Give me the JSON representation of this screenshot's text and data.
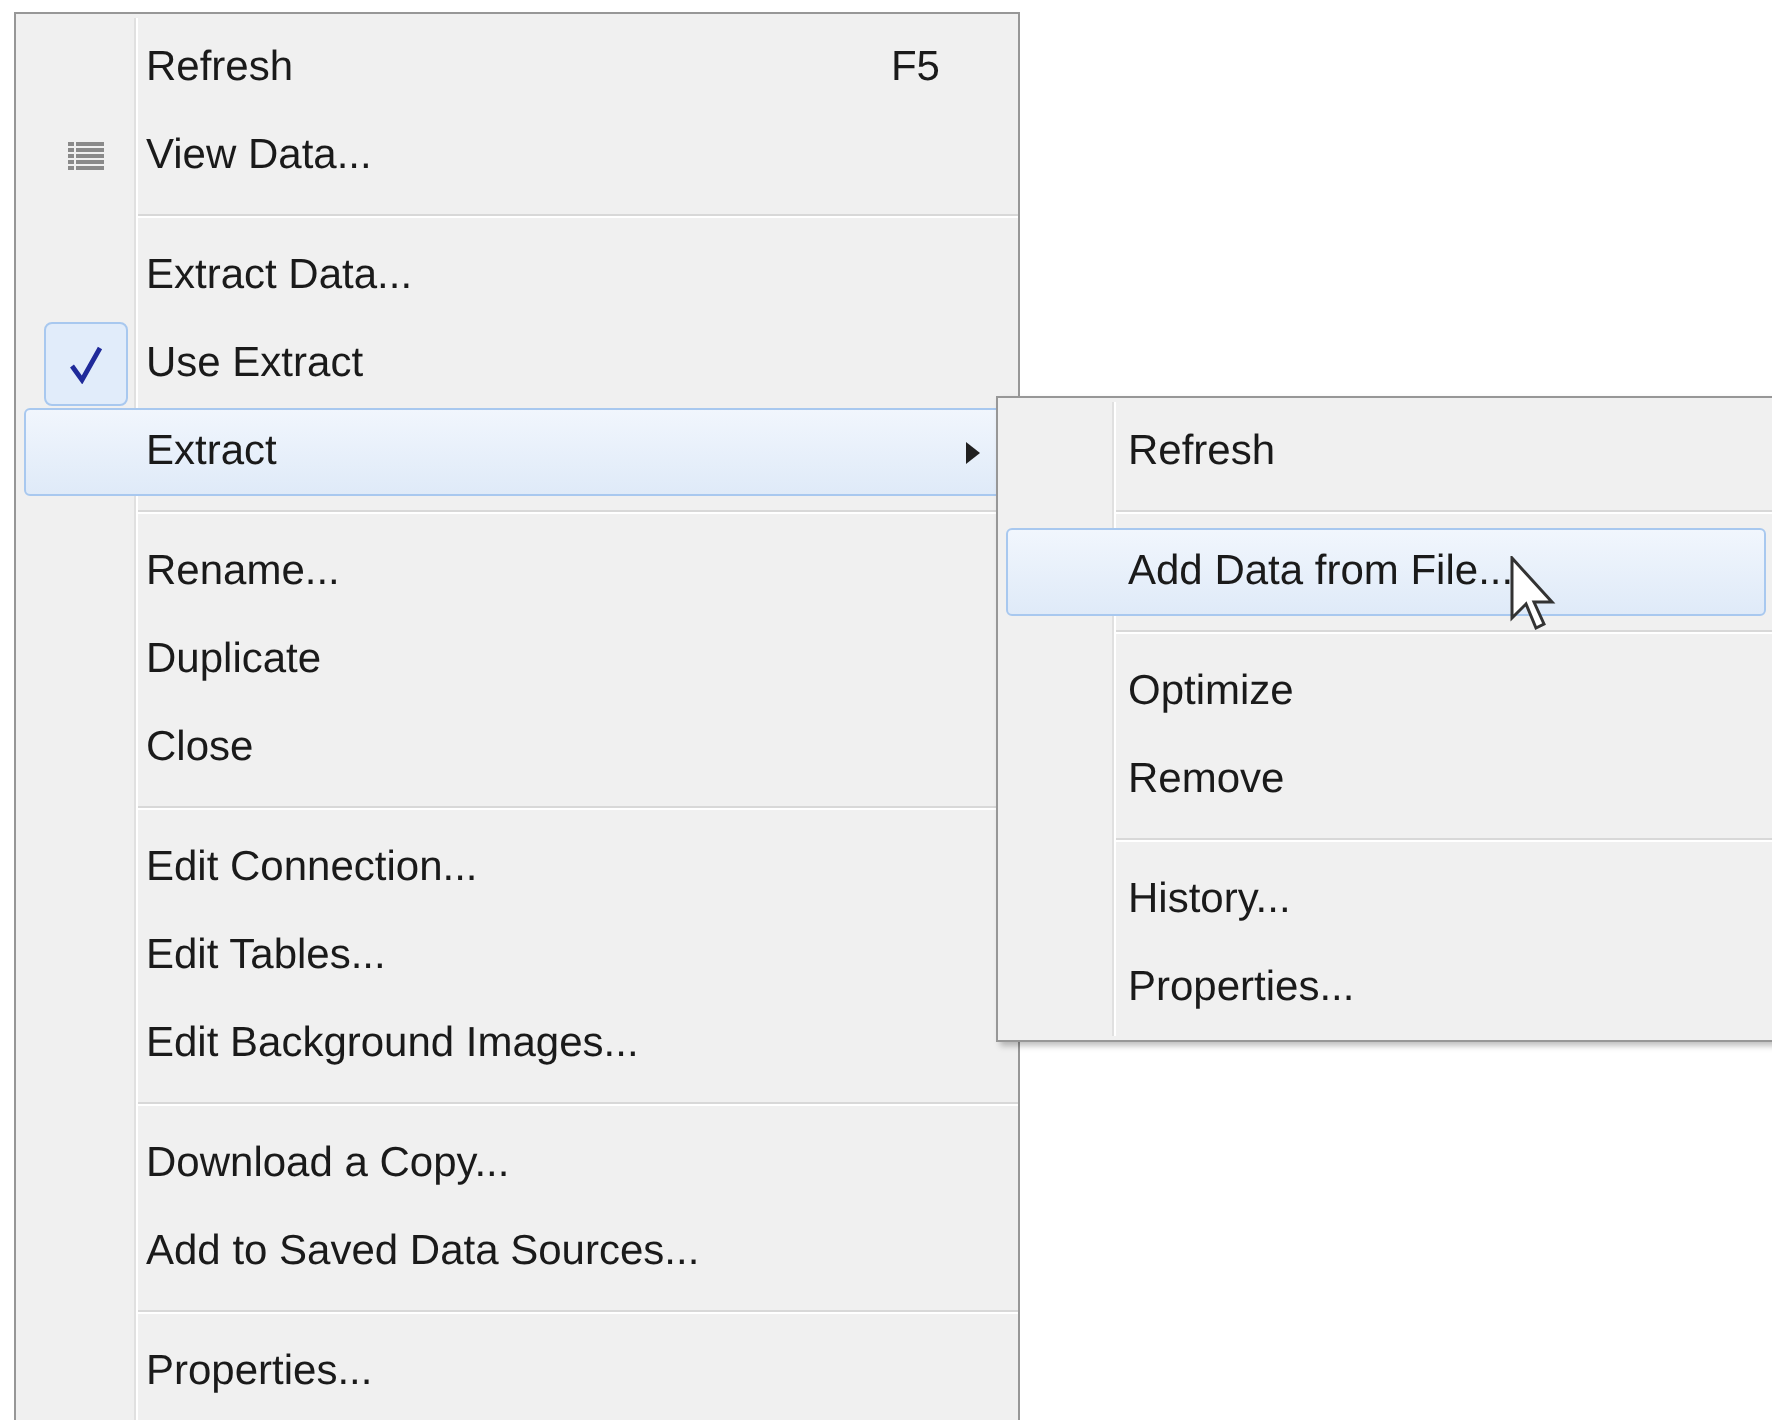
{
  "main_menu": {
    "items": [
      {
        "kind": "item",
        "label": "Refresh",
        "shortcut": "F5"
      },
      {
        "kind": "icon-item",
        "label": "View Data..."
      },
      {
        "kind": "separator"
      },
      {
        "kind": "item",
        "label": "Extract Data..."
      },
      {
        "kind": "check",
        "label": "Use Extract",
        "checked": true
      },
      {
        "kind": "submenu",
        "label": "Extract",
        "selected": true
      },
      {
        "kind": "separator"
      },
      {
        "kind": "item",
        "label": "Rename..."
      },
      {
        "kind": "item",
        "label": "Duplicate"
      },
      {
        "kind": "item",
        "label": "Close"
      },
      {
        "kind": "separator"
      },
      {
        "kind": "item",
        "label": "Edit Connection..."
      },
      {
        "kind": "item",
        "label": "Edit Tables..."
      },
      {
        "kind": "item",
        "label": "Edit Background Images..."
      },
      {
        "kind": "separator"
      },
      {
        "kind": "item",
        "label": "Download a Copy..."
      },
      {
        "kind": "item",
        "label": "Add to Saved Data Sources..."
      },
      {
        "kind": "separator"
      },
      {
        "kind": "item",
        "label": "Properties..."
      }
    ]
  },
  "submenu": {
    "items": [
      {
        "kind": "item",
        "label": "Refresh",
        "selected": false
      },
      {
        "kind": "separator"
      },
      {
        "kind": "item",
        "label": "Add Data from File...",
        "selected": true
      },
      {
        "kind": "separator"
      },
      {
        "kind": "item",
        "label": "Optimize",
        "selected": false
      },
      {
        "kind": "item",
        "label": "Remove",
        "selected": false
      },
      {
        "kind": "separator"
      },
      {
        "kind": "item",
        "label": "History...",
        "selected": false
      },
      {
        "kind": "item",
        "label": "Properties...",
        "selected": false
      }
    ]
  }
}
